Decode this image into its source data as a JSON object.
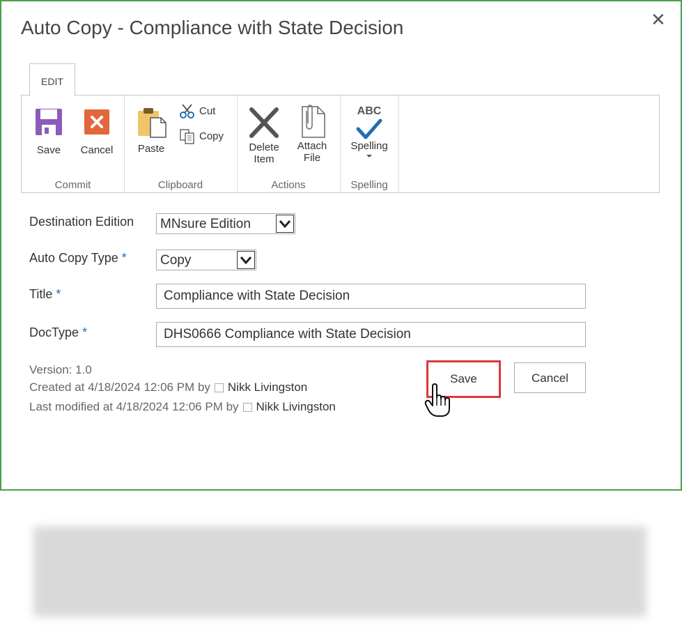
{
  "dialog": {
    "title": "Auto Copy - Compliance with State Decision",
    "close_glyph": "✕"
  },
  "ribbon": {
    "tab": "EDIT",
    "groups": {
      "commit": {
        "label": "Commit",
        "save": "Save",
        "cancel": "Cancel"
      },
      "clipboard": {
        "label": "Clipboard",
        "paste": "Paste",
        "cut": "Cut",
        "copy": "Copy"
      },
      "actions": {
        "label": "Actions",
        "delete_line1": "Delete",
        "delete_line2": "Item",
        "attach_line1": "Attach",
        "attach_line2": "File"
      },
      "spelling": {
        "label": "Spelling",
        "spelling": "Spelling",
        "abc": "ABC"
      }
    }
  },
  "form": {
    "destination_edition": {
      "label": "Destination Edition",
      "value": "MNsure Edition"
    },
    "auto_copy_type": {
      "label": "Auto Copy Type",
      "required_mark": "*",
      "value": "Copy"
    },
    "title": {
      "label": "Title",
      "required_mark": "*",
      "value": "Compliance with State Decision"
    },
    "doctype": {
      "label": "DocType",
      "required_mark": "*",
      "value": "DHS0666 Compliance with State Decision"
    }
  },
  "meta": {
    "version": "Version: 1.0",
    "created": "Created at 4/18/2024 12:06 PM  by",
    "created_by": "Nikk Livingston",
    "modified": "Last modified at 4/18/2024 12:06 PM  by",
    "modified_by": "Nikk Livingston"
  },
  "buttons": {
    "save": "Save",
    "cancel": "Cancel"
  },
  "colors": {
    "dialog_border": "#4aa14a",
    "highlight": "#e0363c",
    "required": "#1f6fb5"
  }
}
